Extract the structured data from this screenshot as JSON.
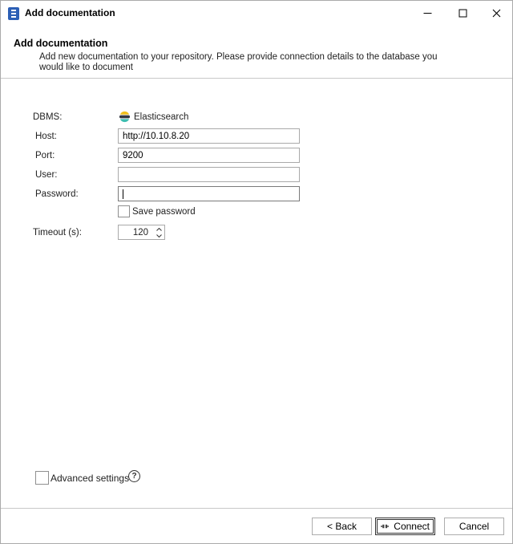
{
  "window": {
    "title": "Add documentation",
    "controls": {
      "minimize": "minimize-icon",
      "maximize": "maximize-icon",
      "close": "close-icon"
    }
  },
  "header": {
    "title": "Add documentation",
    "description": "Add new documentation to your repository. Please provide connection details to the database you would like to document"
  },
  "form": {
    "dbms_label": "DBMS:",
    "dbms_value": "Elasticsearch",
    "host_label": "Host:",
    "host_value": "http://10.10.8.20",
    "port_label": "Port:",
    "port_value": "9200",
    "user_label": "User:",
    "user_value": "",
    "password_label": "Password:",
    "password_value": "",
    "save_password_label": "Save password",
    "save_password_checked": false,
    "timeout_label": "Timeout (s):",
    "timeout_value": "120"
  },
  "advanced": {
    "label": "Advanced settings",
    "checked": false,
    "help_symbol": "?"
  },
  "footer": {
    "back_label": "< Back",
    "connect_label": "Connect",
    "cancel_label": "Cancel"
  },
  "colors": {
    "accent": "#0078d7",
    "border": "#a9a9a9",
    "elastic_yellow": "#f0bf1a",
    "elastic_teal": "#3ebeb0",
    "elastic_blue": "#07a5de",
    "app_icon": "#2c5fb5"
  }
}
